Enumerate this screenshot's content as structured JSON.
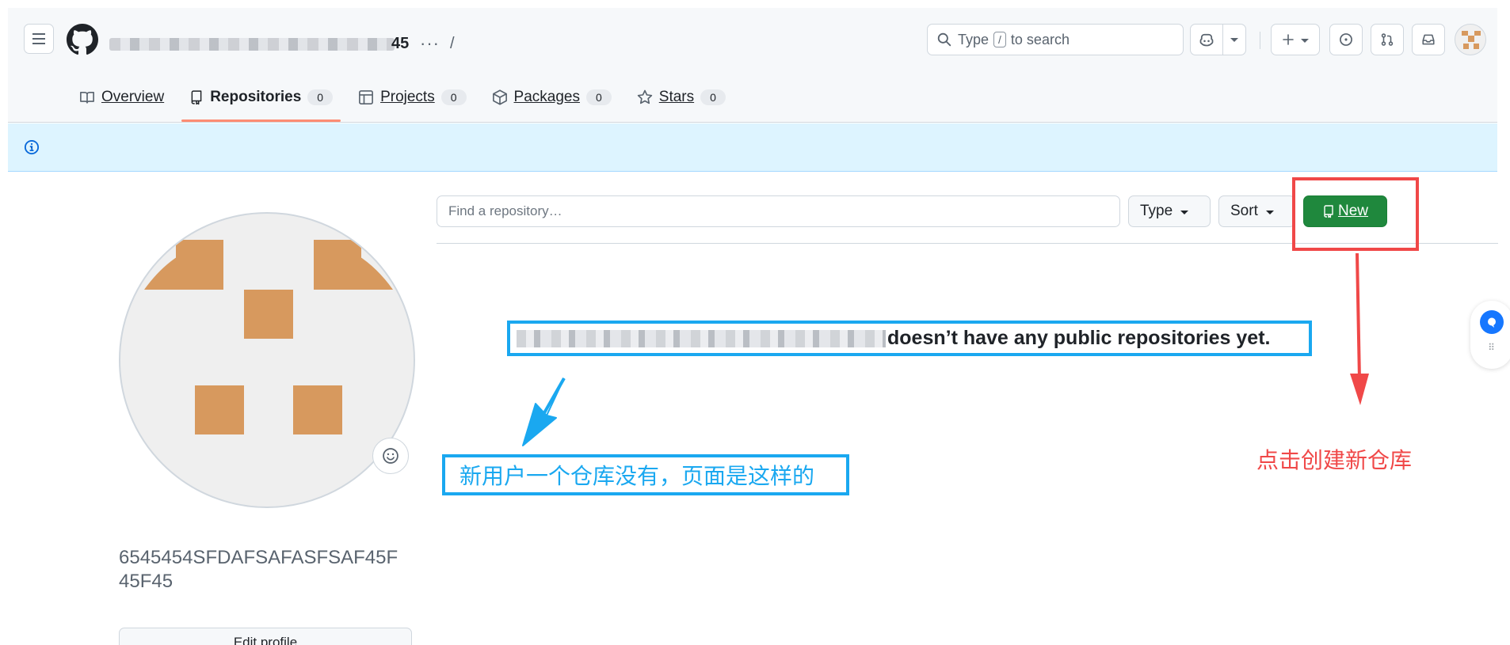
{
  "header": {
    "username_visible_tail": "45",
    "more_label": "···",
    "path_separator": "/",
    "search": {
      "prefix": "Type",
      "key": "/",
      "suffix": "to search"
    }
  },
  "tabs": [
    {
      "label": "Overview",
      "icon": "book-icon",
      "count": null,
      "active": false
    },
    {
      "label": "Repositories",
      "icon": "repo-icon",
      "count": "0",
      "active": true
    },
    {
      "label": "Projects",
      "icon": "table-icon",
      "count": "0",
      "active": false
    },
    {
      "label": "Packages",
      "icon": "package-icon",
      "count": "0",
      "active": false
    },
    {
      "label": "Stars",
      "icon": "star-icon",
      "count": "0",
      "active": false
    }
  ],
  "profile": {
    "full_name": "6545454SFDAFSAFASFSAF45F45F45",
    "edit_profile": "Edit profile"
  },
  "repos": {
    "find_placeholder": "Find a repository…",
    "type_label": "Type",
    "sort_label": "Sort",
    "new_label": "New",
    "empty_message": "doesn’t have any public repositories yet."
  },
  "annotations": {
    "blue_note": "新用户一个仓库没有，页面是这样的",
    "red_note": "点击创建新仓库"
  },
  "colors": {
    "accent_green": "#1f883d",
    "banner_bg": "#ddf4ff",
    "annotation_blue": "#1aa8f0",
    "annotation_red": "#f04848",
    "avatar_orange": "#d7995e",
    "tab_underline": "#fd8c73"
  }
}
